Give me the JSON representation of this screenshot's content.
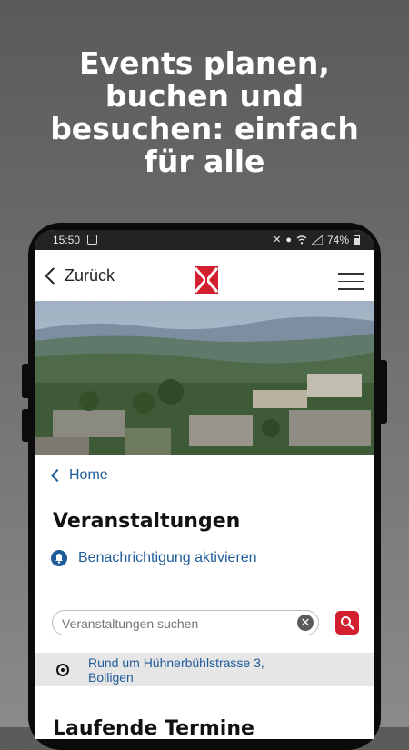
{
  "headline": {
    "lines": [
      "Events planen,",
      "buchen und",
      "besuchen: einfach",
      "für alle"
    ]
  },
  "status_bar": {
    "time": "15:50",
    "battery": "74%"
  },
  "app_bar": {
    "back_label": "Zurück",
    "logo_icon": "municipal-logo-icon",
    "menu_icon": "hamburger-menu-icon"
  },
  "breadcrumb": {
    "home_label": "Home"
  },
  "page": {
    "title": "Veranstaltungen",
    "notify_label": "Benachrichtigung aktivieren"
  },
  "search": {
    "placeholder": "Veranstaltungen suchen"
  },
  "location": {
    "text": "Rund um Hühnerbühlstrasse 3, Bolligen"
  },
  "section": {
    "heading": "Laufende Termine"
  },
  "colors": {
    "link_blue": "#1f5c99",
    "brand_red": "#d22030",
    "status_bar": "#232323"
  }
}
